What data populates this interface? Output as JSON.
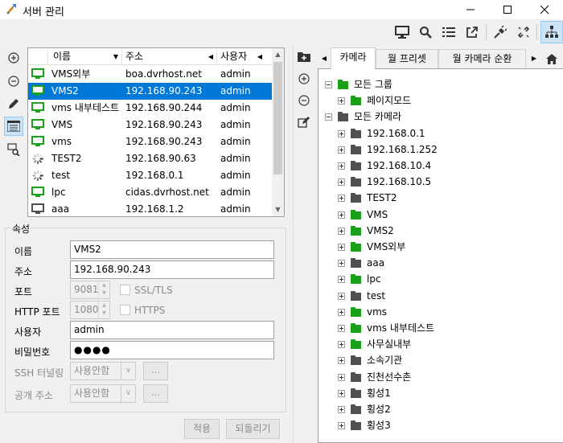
{
  "window": {
    "title": "서버 관리"
  },
  "colors": {
    "accent": "#0078d7",
    "folder_green": "#1aa11a",
    "folder_dark": "#505050",
    "monitor_green": "#1aa11a"
  },
  "toolbar": {
    "icons": [
      "monitor-icon",
      "search-icon",
      "list-icon",
      "external-link-icon",
      "plug-icon",
      "unlink-icon",
      "network-tree-icon"
    ]
  },
  "left_strip": {
    "icons": [
      "add-icon",
      "remove-icon",
      "edit-icon",
      "server-list-icon",
      "server-search-icon"
    ]
  },
  "server_list": {
    "columns": [
      "이름",
      "주소",
      "사용자"
    ],
    "rows": [
      {
        "name": "VMS외부",
        "address": "boa.dvrhost.net",
        "user": "admin",
        "icon": "monitor-green"
      },
      {
        "name": "VMS2",
        "address": "192.168.90.243",
        "user": "admin",
        "icon": "monitor-green",
        "selected": true
      },
      {
        "name": "vms 내부테스트",
        "address": "192.168.90.244",
        "user": "admin",
        "icon": "monitor-green"
      },
      {
        "name": "VMS",
        "address": "192.168.90.243",
        "user": "admin",
        "icon": "monitor-green"
      },
      {
        "name": "vms",
        "address": "192.168.90.243",
        "user": "admin",
        "icon": "monitor-green"
      },
      {
        "name": "TEST2",
        "address": "192.168.90.63",
        "user": "admin",
        "icon": "spinner"
      },
      {
        "name": "test",
        "address": "192.168.0.1",
        "user": "admin",
        "icon": "spinner"
      },
      {
        "name": "lpc",
        "address": "cidas.dvrhost.net",
        "user": "admin",
        "icon": "monitor-green"
      },
      {
        "name": "aaa",
        "address": "192.168.1.2",
        "user": "admin",
        "icon": "monitor-dark"
      }
    ]
  },
  "properties": {
    "group_title": "속성",
    "name_label": "이름",
    "name_value": "VMS2",
    "address_label": "주소",
    "address_value": "192.168.90.243",
    "port_label": "포트",
    "port_value": "9081",
    "ssl_label": "SSL/TLS",
    "http_port_label": "HTTP 포트",
    "http_port_value": "1080",
    "https_label": "HTTPS",
    "user_label": "사용자",
    "user_value": "admin",
    "password_label": "비밀번호",
    "password_value": "●●●●",
    "ssh_label": "SSH 터널링",
    "ssh_value": "사용안함",
    "public_label": "공개 주소",
    "public_value": "사용안함",
    "dots_label": "...",
    "apply_label": "적용",
    "revert_label": "되돌리기"
  },
  "right_pane": {
    "tabs": [
      "카메라",
      "월 프리셋",
      "월 카메라 순환"
    ],
    "active_tab": "카메라",
    "tree": [
      {
        "label": "모든 그룹",
        "level": 0,
        "expander": "minus",
        "folder": "green"
      },
      {
        "label": "페이지모드",
        "level": 1,
        "expander": "plus",
        "folder": "green"
      },
      {
        "label": "모든 카메라",
        "level": 0,
        "expander": "minus",
        "folder": "dark"
      },
      {
        "label": "192.168.0.1",
        "level": 1,
        "expander": "plus",
        "folder": "dark"
      },
      {
        "label": "192.168.1.252",
        "level": 1,
        "expander": "plus",
        "folder": "dark"
      },
      {
        "label": "192.168.10.4",
        "level": 1,
        "expander": "plus",
        "folder": "dark"
      },
      {
        "label": "192.168.10.5",
        "level": 1,
        "expander": "plus",
        "folder": "dark"
      },
      {
        "label": "TEST2",
        "level": 1,
        "expander": "plus",
        "folder": "dark"
      },
      {
        "label": "VMS",
        "level": 1,
        "expander": "plus",
        "folder": "green"
      },
      {
        "label": "VMS2",
        "level": 1,
        "expander": "plus",
        "folder": "green"
      },
      {
        "label": "VMS외부",
        "level": 1,
        "expander": "plus",
        "folder": "green"
      },
      {
        "label": "aaa",
        "level": 1,
        "expander": "plus",
        "folder": "dark"
      },
      {
        "label": "lpc",
        "level": 1,
        "expander": "plus",
        "folder": "green"
      },
      {
        "label": "test",
        "level": 1,
        "expander": "plus",
        "folder": "dark"
      },
      {
        "label": "vms",
        "level": 1,
        "expander": "plus",
        "folder": "green"
      },
      {
        "label": "vms 내부테스트",
        "level": 1,
        "expander": "plus",
        "folder": "green"
      },
      {
        "label": "사무실내부",
        "level": 1,
        "expander": "plus",
        "folder": "green"
      },
      {
        "label": "소속기관",
        "level": 1,
        "expander": "plus",
        "folder": "dark"
      },
      {
        "label": "진천선수촌",
        "level": 1,
        "expander": "plus",
        "folder": "dark"
      },
      {
        "label": "횡성1",
        "level": 1,
        "expander": "plus",
        "folder": "dark"
      },
      {
        "label": "횡성2",
        "level": 1,
        "expander": "plus",
        "folder": "dark"
      },
      {
        "label": "횡성3",
        "level": 1,
        "expander": "plus",
        "folder": "dark"
      }
    ]
  }
}
